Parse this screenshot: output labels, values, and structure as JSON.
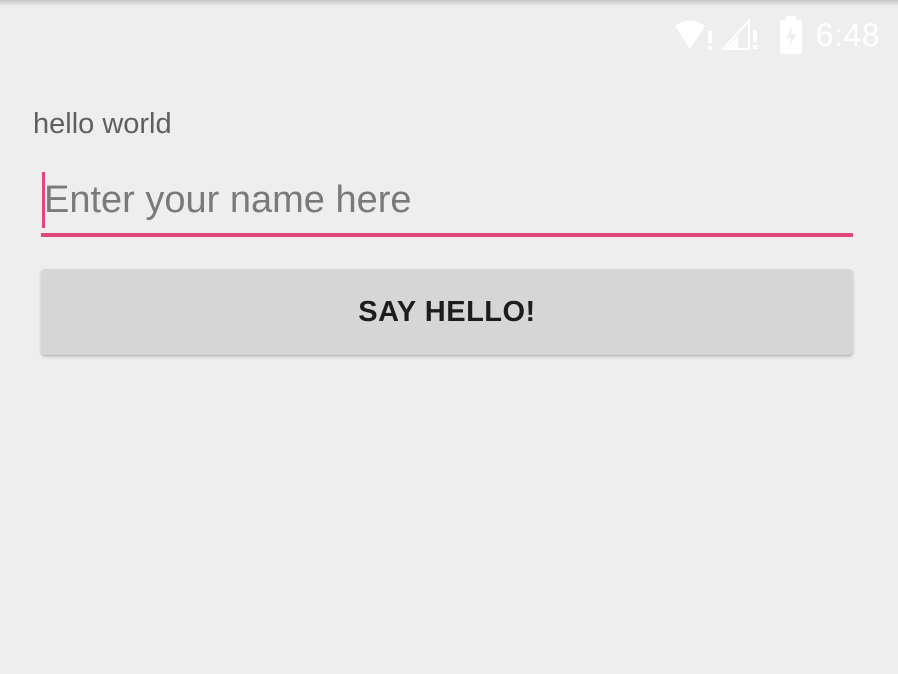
{
  "status_bar": {
    "time": "6:48",
    "icons": [
      "wifi-icon",
      "signal-icon",
      "battery-charging-icon"
    ],
    "icon_color": "#ffffff"
  },
  "main": {
    "hello_text": "hello world",
    "name_input": {
      "value": "",
      "placeholder": "Enter your name here"
    },
    "say_hello_button": "SAY HELLO!"
  },
  "colors": {
    "background": "#eeeeee",
    "accent": "#e0487a",
    "button": "#d6d6d6"
  }
}
